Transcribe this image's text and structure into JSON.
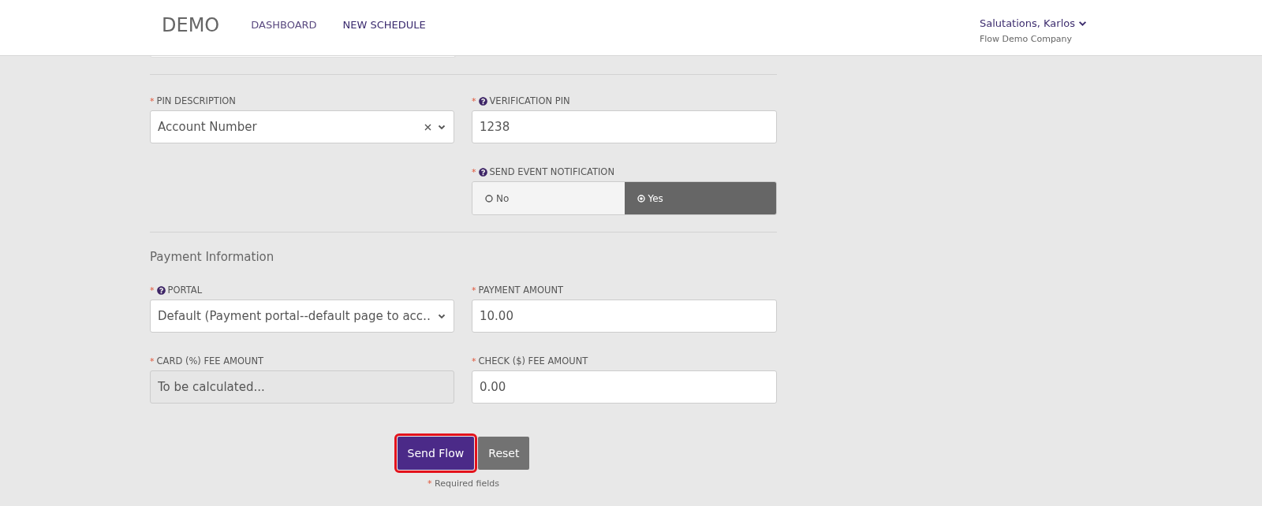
{
  "header": {
    "logo": "DEMO",
    "nav": [
      {
        "label": "DASHBOARD",
        "selected": false
      },
      {
        "label": "NEW SCHEDULE",
        "selected": true
      }
    ],
    "user": {
      "greeting": "Salutations, Karlos",
      "company": "Flow Demo Company"
    }
  },
  "sections": [
    {
      "rows": [
        [
          {
            "kind": "select",
            "label": "PIN DESCRIPTION",
            "required": true,
            "help": false,
            "value": "Account Number",
            "clearable": true
          },
          {
            "kind": "text",
            "label": "VERIFICATION PIN",
            "required": true,
            "help": true,
            "value": "1238"
          }
        ],
        [
          null,
          {
            "kind": "toggle",
            "label": "SEND EVENT NOTIFICATION",
            "required": true,
            "help": true,
            "options": [
              {
                "label": "No",
                "selected": false
              },
              {
                "label": "Yes",
                "selected": true
              }
            ]
          }
        ]
      ]
    },
    {
      "title": "Payment Information",
      "rows": [
        [
          {
            "kind": "select",
            "label": "PORTAL",
            "required": true,
            "help": true,
            "value": "Default (Payment portal--default page to acc…",
            "clearable": false
          },
          {
            "kind": "text",
            "label": "PAYMENT AMOUNT",
            "required": true,
            "help": false,
            "value": "10.00"
          }
        ],
        [
          {
            "kind": "readonly",
            "label": "CARD (%) FEE AMOUNT",
            "required": true,
            "help": false,
            "value": "To be calculated..."
          },
          {
            "kind": "text",
            "label": "CHECK ($) FEE AMOUNT",
            "required": true,
            "help": false,
            "value": "0.00"
          }
        ]
      ]
    }
  ],
  "buttons": [
    {
      "label": "Send Flow",
      "kind": "primary",
      "highlighted": true
    },
    {
      "label": "Reset",
      "kind": "secondary",
      "highlighted": false
    }
  ],
  "footnote": {
    "mark": "*",
    "text": "Required fields"
  }
}
